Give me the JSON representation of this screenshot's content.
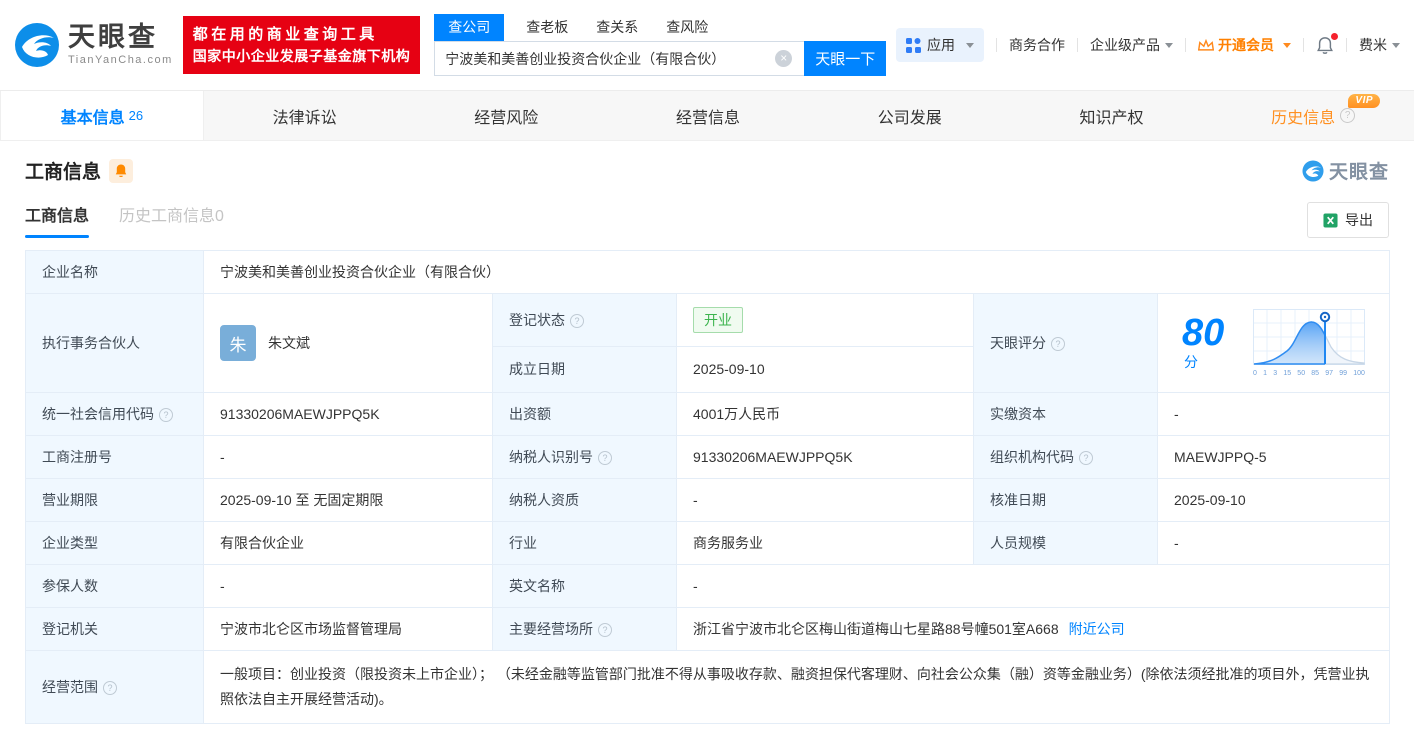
{
  "colors": {
    "accent": "#0084ff",
    "banner_red": "#e60113",
    "vip_orange": "#ff9021",
    "status_green": "#3cb44e"
  },
  "icons": {
    "help": "?",
    "clear": "×"
  },
  "header": {
    "logo": {
      "brand": "天眼查",
      "domain": "TianYanCha.com"
    },
    "slogan": {
      "line1": "都在用的商业查询工具",
      "line2": "国家中小企业发展子基金旗下机构"
    },
    "search": {
      "tabs": [
        {
          "label": "查公司",
          "active": true
        },
        {
          "label": "查老板",
          "active": false
        },
        {
          "label": "查关系",
          "active": false
        },
        {
          "label": "查风险",
          "active": false
        }
      ],
      "value": "宁波美和美善创业投资合伙企业（有限合伙）",
      "button": "天眼一下"
    },
    "nav": {
      "apps": "应用",
      "cooperation": "商务合作",
      "enterprise": "企业级产品",
      "vip": "开通会员",
      "user": "费米"
    }
  },
  "main_tabs": {
    "items": [
      {
        "label": "基本信息",
        "count": "26",
        "active": true
      },
      {
        "label": "法律诉讼"
      },
      {
        "label": "经营风险"
      },
      {
        "label": "经营信息"
      },
      {
        "label": "公司发展"
      },
      {
        "label": "知识产权"
      },
      {
        "label": "历史信息",
        "vip": "VIP",
        "highlight": true
      }
    ]
  },
  "section": {
    "title": "工商信息",
    "watermark": "天眼查",
    "sub_tabs": [
      {
        "label": "工商信息",
        "active": true
      },
      {
        "label": "历史工商信息0",
        "active": false
      }
    ],
    "export_label": "导出"
  },
  "table": {
    "company_name": {
      "label": "企业名称",
      "value": "宁波美和美善创业投资合伙企业（有限合伙）"
    },
    "partner": {
      "label": "执行事务合伙人",
      "avatar": "朱",
      "name": "朱文斌"
    },
    "reg_status": {
      "label": "登记状态",
      "value": "开业"
    },
    "establish_date": {
      "label": "成立日期",
      "value": "2025-09-10"
    },
    "score": {
      "label": "天眼评分",
      "value": "80",
      "unit": "分",
      "axis": [
        "0",
        "1",
        "3",
        "15",
        "50",
        "85",
        "97",
        "99",
        "100"
      ]
    },
    "credit_code": {
      "label": "统一社会信用代码",
      "value": "91330206MAEWJPPQ5K"
    },
    "capital": {
      "label": "出资额",
      "value": "4001万人民币"
    },
    "paid_capital": {
      "label": "实缴资本",
      "value": "-"
    },
    "reg_number": {
      "label": "工商注册号",
      "value": "-"
    },
    "taxpayer_id": {
      "label": "纳税人识别号",
      "value": "91330206MAEWJPPQ5K"
    },
    "org_code": {
      "label": "组织机构代码",
      "value": "MAEWJPPQ-5"
    },
    "business_term": {
      "label": "营业期限",
      "value": "2025-09-10 至 无固定期限"
    },
    "taxpayer_quality": {
      "label": "纳税人资质",
      "value": "-"
    },
    "approval_date": {
      "label": "核准日期",
      "value": "2025-09-10"
    },
    "company_type": {
      "label": "企业类型",
      "value": "有限合伙企业"
    },
    "industry": {
      "label": "行业",
      "value": "商务服务业"
    },
    "staff_size": {
      "label": "人员规模",
      "value": "-"
    },
    "insured_count": {
      "label": "参保人数",
      "value": "-"
    },
    "english_name": {
      "label": "英文名称",
      "value": "-"
    },
    "reg_authority": {
      "label": "登记机关",
      "value": "宁波市北仑区市场监督管理局"
    },
    "business_address": {
      "label": "主要经营场所",
      "value": "浙江省宁波市北仑区梅山街道梅山七星路88号幢501室A668",
      "link": "附近公司"
    },
    "business_scope": {
      "label": "经营范围",
      "value": "一般项目：创业投资（限投资未上市企业）； （未经金融等监管部门批准不得从事吸收存款、融资担保代客理财、向社会公众集（融）资等金融业务）(除依法须经批准的项目外，凭营业执照依法自主开展经营活动)。"
    }
  }
}
